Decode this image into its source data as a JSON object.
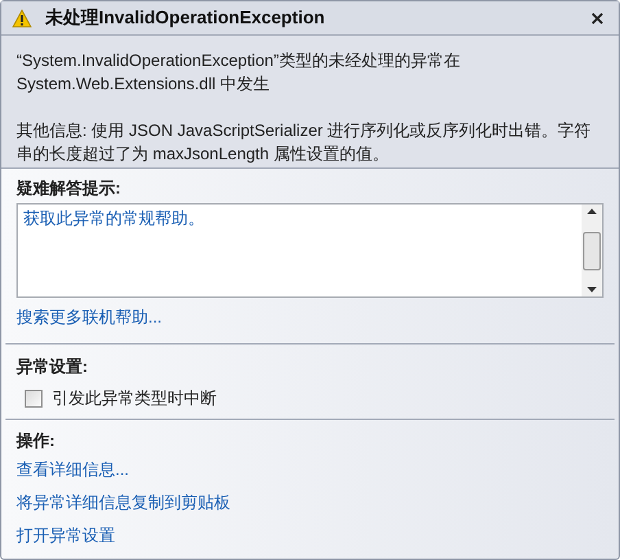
{
  "window": {
    "title": "未处理InvalidOperationException"
  },
  "message": "“System.InvalidOperationException”类型的未经处理的异常在 System.Web.Extensions.dll 中发生",
  "details": "其他信息: 使用 JSON JavaScriptSerializer 进行序列化或反序列化时出错。字符串的长度超过了为 maxJsonLength 属性设置的值。",
  "troubleshooting": {
    "heading": "疑难解答提示:",
    "tips": [
      "获取此异常的常规帮助。"
    ],
    "search_link": "搜索更多联机帮助..."
  },
  "exception_settings": {
    "heading": "异常设置:",
    "options": [
      {
        "label": "引发此异常类型时中断",
        "checked": false
      }
    ]
  },
  "actions": {
    "heading": "操作:",
    "links": [
      "查看详细信息...",
      "将异常详细信息复制到剪贴板",
      "打开异常设置"
    ]
  }
}
